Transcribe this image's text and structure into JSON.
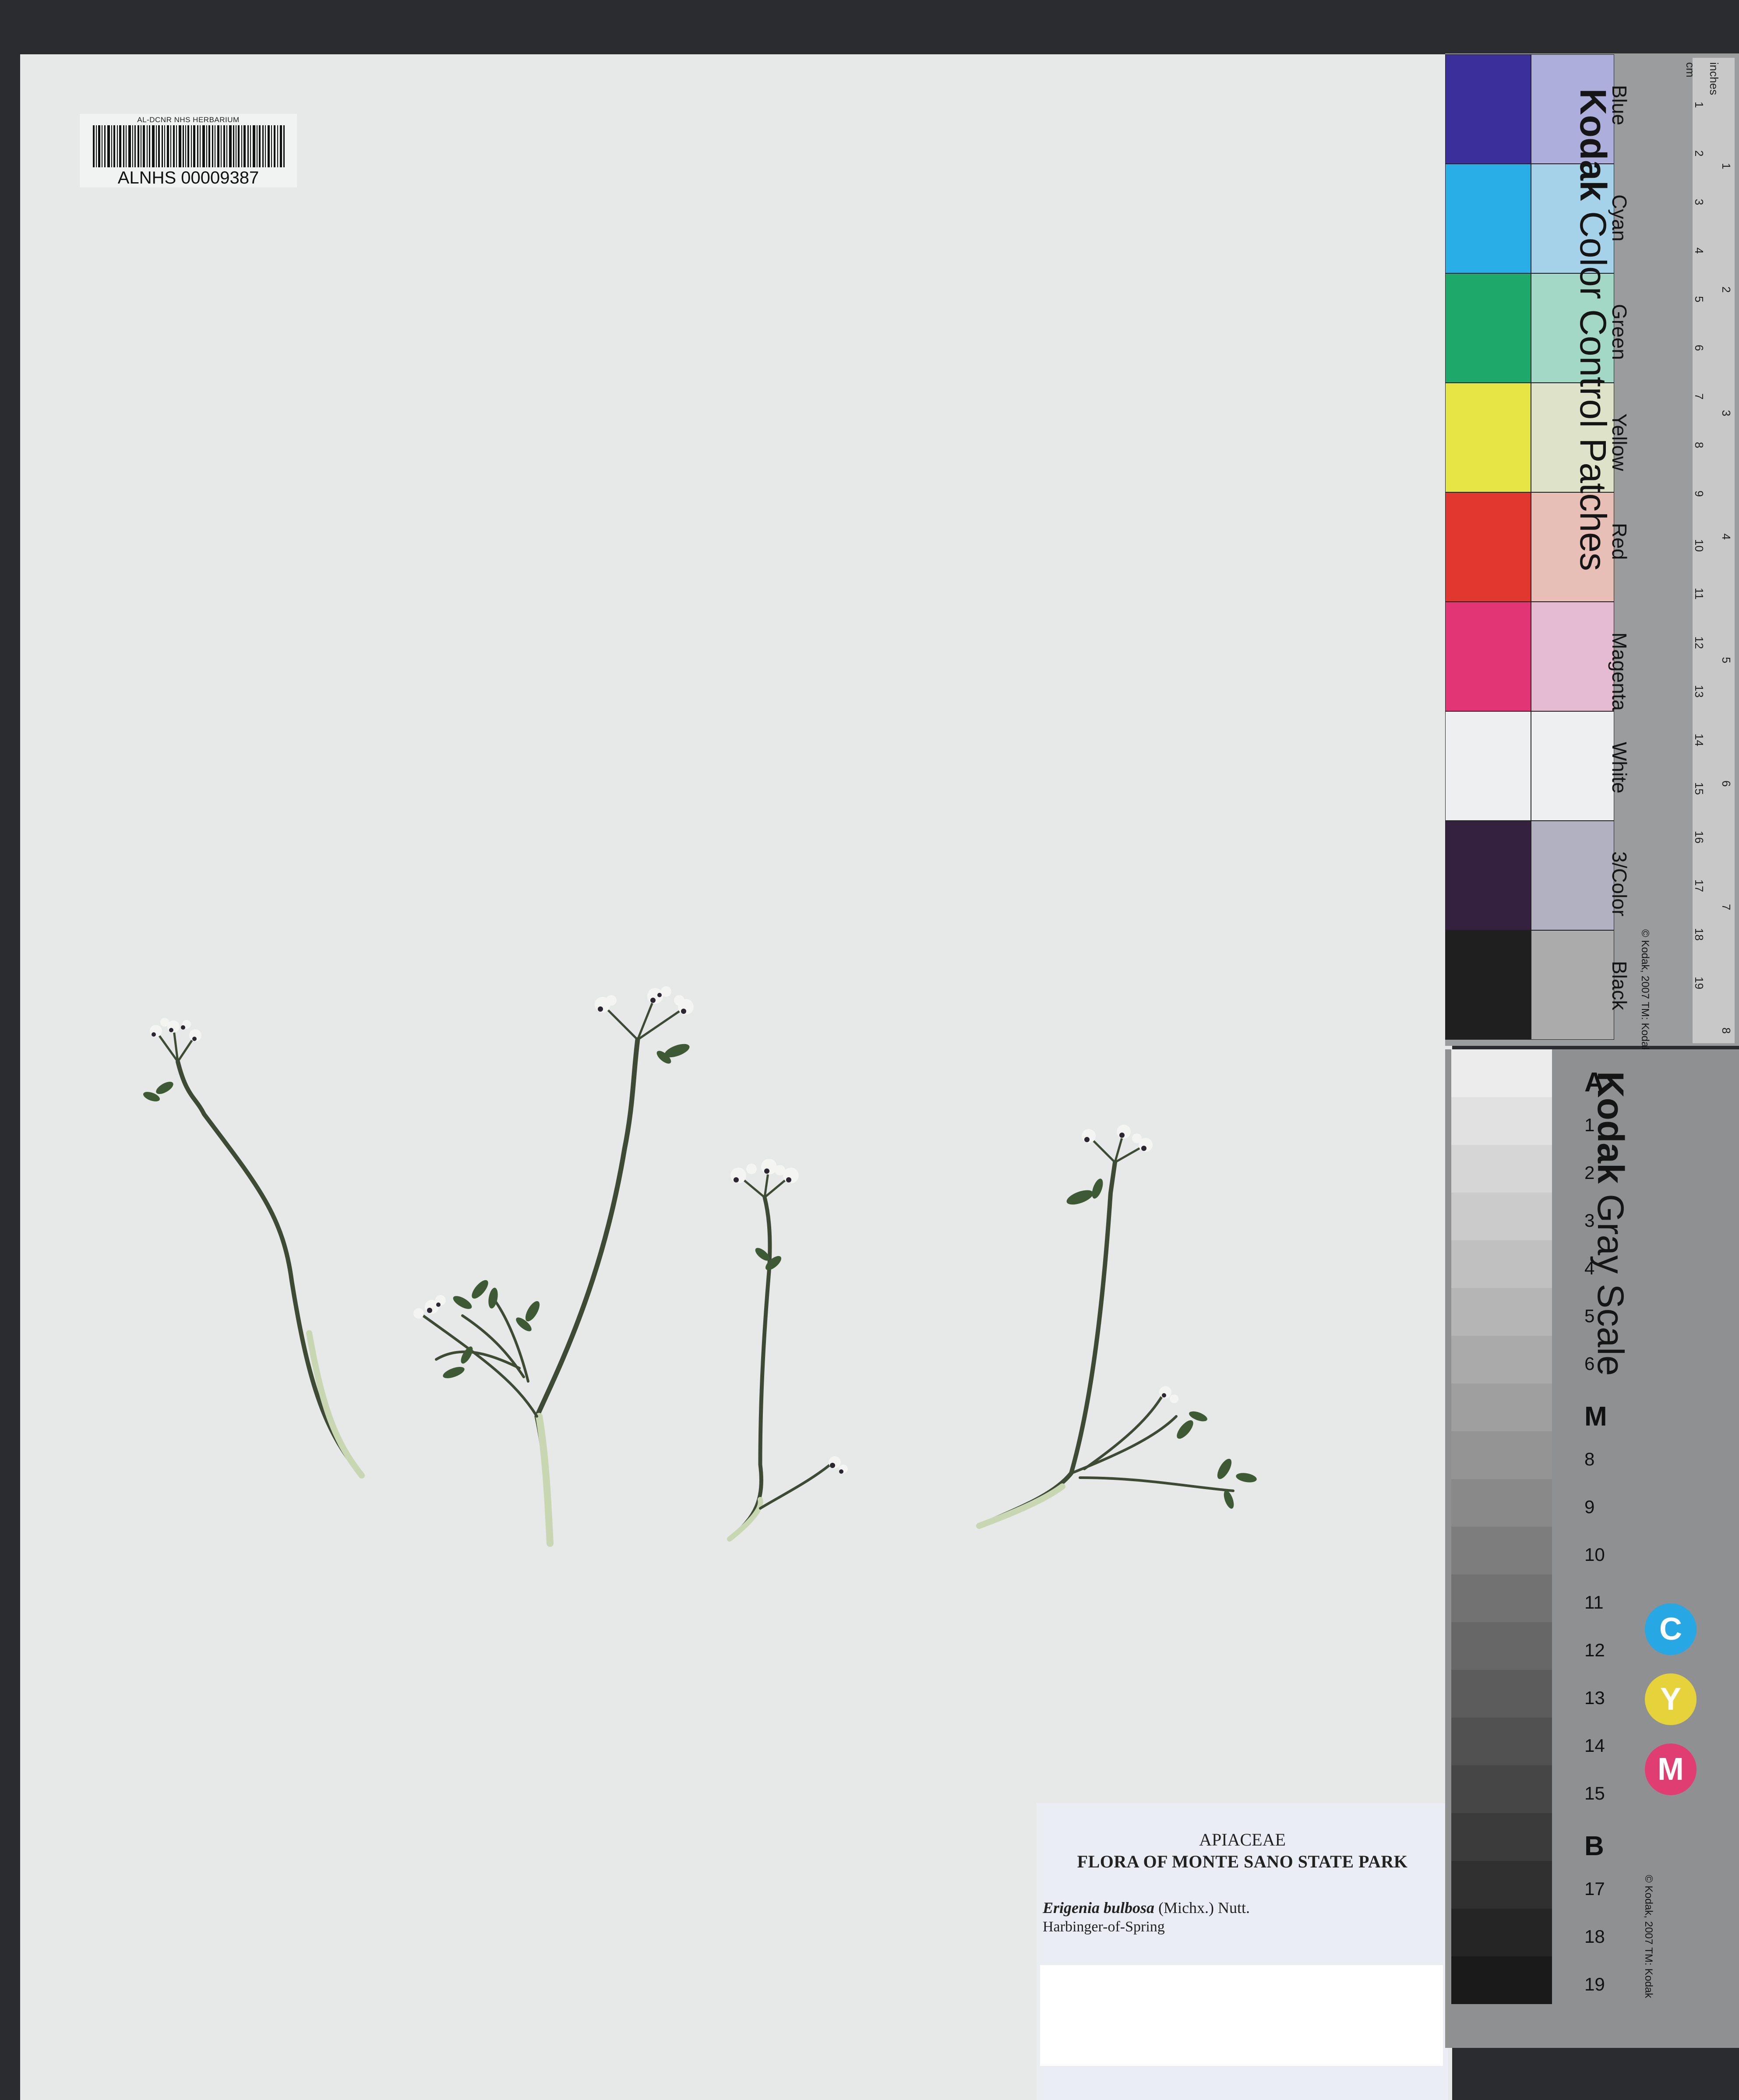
{
  "barcode": {
    "institution": "AL-DCNR NHS HERBARIUM",
    "number": "ALNHS 00009387"
  },
  "label": {
    "family": "APIACEAE",
    "flora": "FLORA OF MONTE SANO STATE PARK",
    "scientific_name": "Erigenia bulbosa",
    "authority": "(Michx.) Nutt.",
    "common_name": "Harbinger-of-Spring"
  },
  "color_card": {
    "brand": "Kodak",
    "title": "Color Control Patches",
    "copyright": "© Kodak, 2007 TM: Kodak",
    "ruler_units_cm": "cm",
    "ruler_units_in": "inches",
    "patches": [
      {
        "name": "Blue",
        "color": "#3b2f9c",
        "tint": "#aeaedd"
      },
      {
        "name": "Cyan",
        "color": "#2aaee8",
        "tint": "#a5d2e8"
      },
      {
        "name": "Green",
        "color": "#1ea86a",
        "tint": "#a3d8c7"
      },
      {
        "name": "Yellow",
        "color": "#e5e545",
        "tint": "#dde2c8"
      },
      {
        "name": "Red",
        "color": "#e0382f",
        "tint": "#e8bfb6"
      },
      {
        "name": "Magenta",
        "color": "#e23575",
        "tint": "#e4bbd0"
      },
      {
        "name": "White",
        "color": "#eeeff0",
        "tint": "#eeeff0"
      },
      {
        "name": "3/Color",
        "color": "#33213f",
        "tint": "#b2b1c1"
      },
      {
        "name": "Black",
        "color": "#1f1f1f",
        "tint": "#ababab"
      }
    ],
    "ruler_cm": [
      "1",
      "2",
      "3",
      "4",
      "5",
      "6",
      "7",
      "8",
      "9",
      "10",
      "11",
      "12",
      "13",
      "14",
      "15",
      "16",
      "17",
      "18",
      "19"
    ],
    "ruler_in": [
      "1",
      "2",
      "3",
      "4",
      "5",
      "6",
      "7",
      "8"
    ]
  },
  "gray_card": {
    "brand": "Kodak",
    "title": "Gray Scale",
    "copyright": "© Kodak, 2007 TM: Kodak",
    "steps": [
      "A",
      "1",
      "2",
      "3",
      "4",
      "5",
      "6",
      "M",
      "8",
      "9",
      "10",
      "11",
      "12",
      "13",
      "14",
      "15",
      "B",
      "17",
      "18",
      "19"
    ],
    "cym": [
      {
        "letter": "C",
        "color": "#27a7e3"
      },
      {
        "letter": "Y",
        "color": "#e6d23a"
      },
      {
        "letter": "M",
        "color": "#e03d73"
      }
    ]
  }
}
